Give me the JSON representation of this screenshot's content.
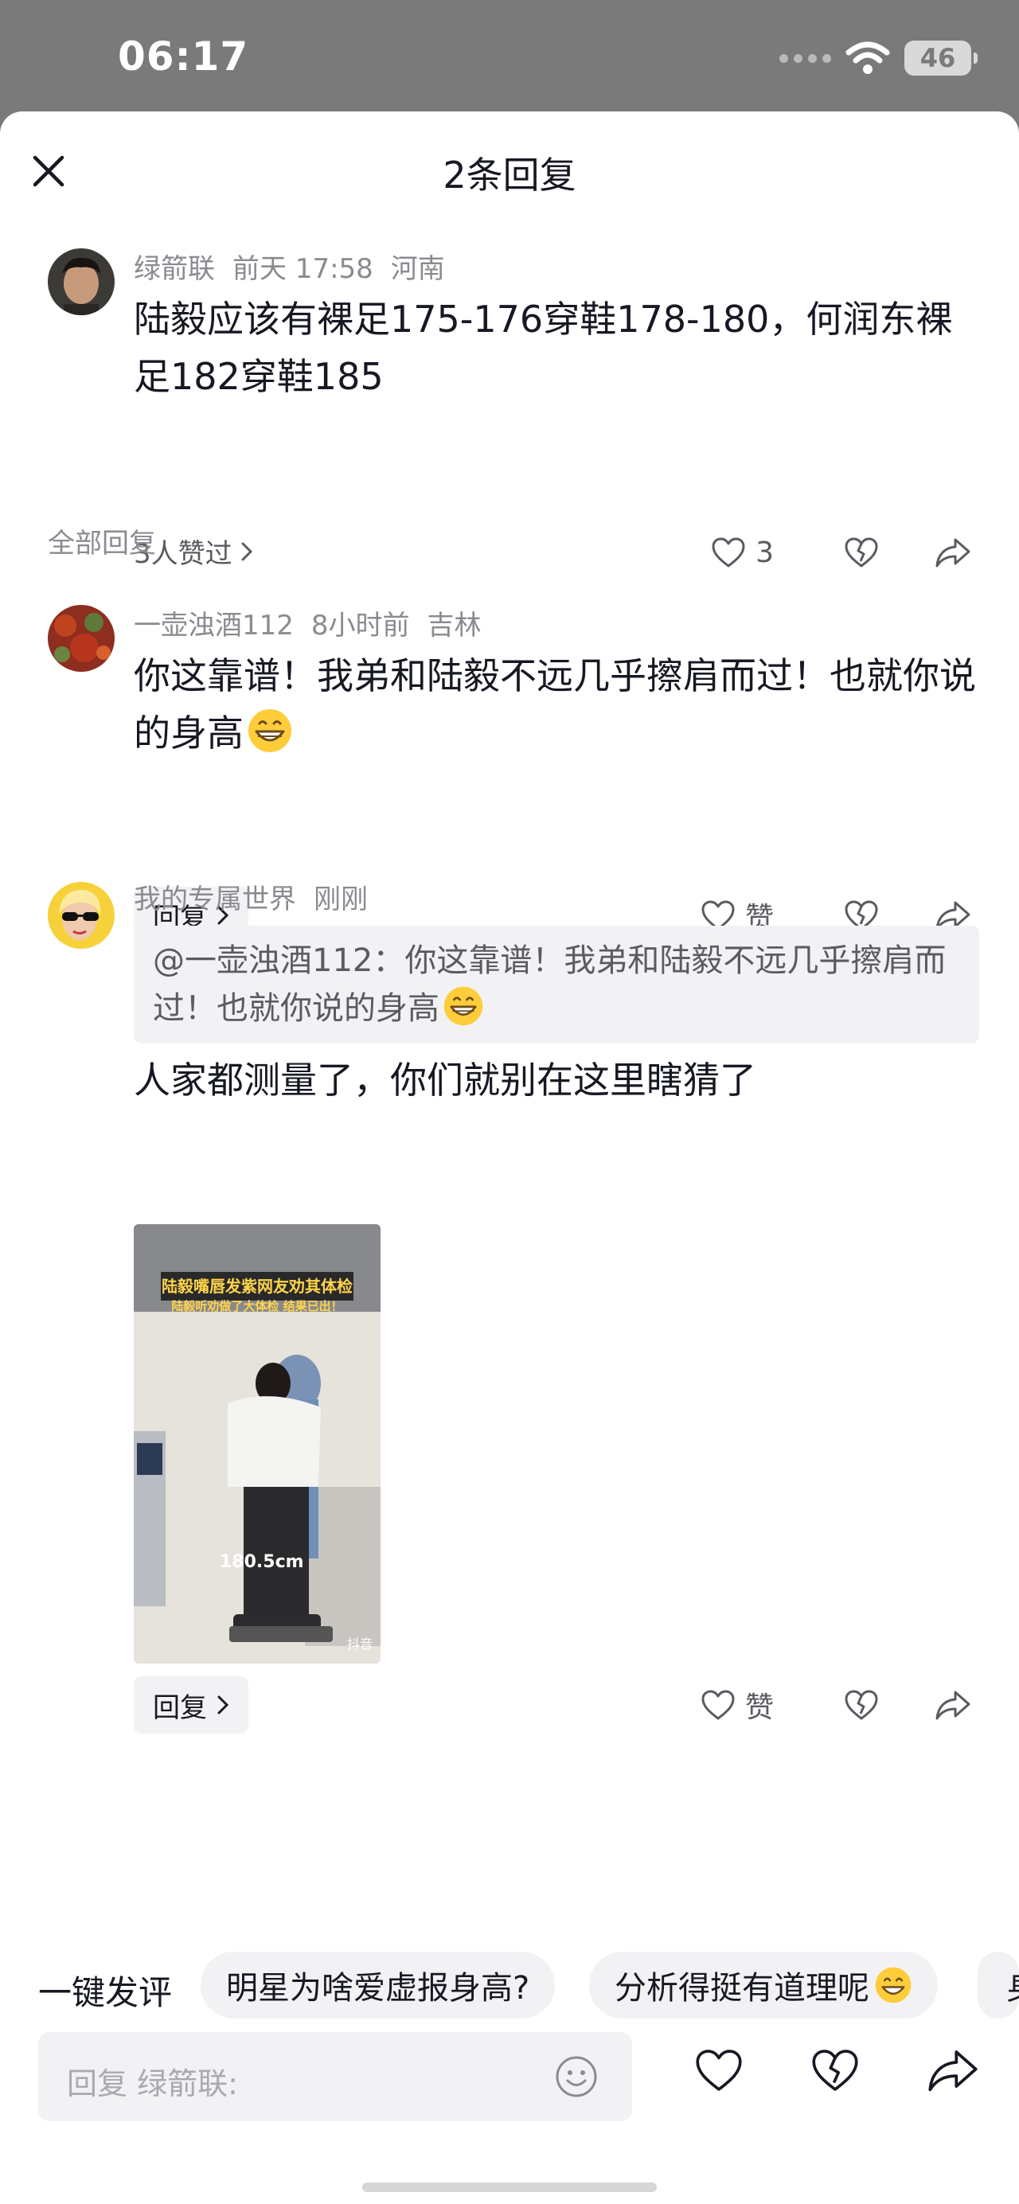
{
  "status": {
    "time": "06:17",
    "battery": "46"
  },
  "header": {
    "title": "2条回复",
    "close_icon": "close-icon"
  },
  "main_comment": {
    "author": "绿箭联",
    "time": "前天 17:58",
    "location": "河南",
    "text": "陆毅应该有裸足175-176穿鞋178-180，何润东裸足182穿鞋185",
    "likes_link": "3人赞过",
    "like_count": "3"
  },
  "section_label": "全部回复",
  "replies": [
    {
      "author": "一壶浊酒112",
      "time": "8小时前",
      "location": "吉林",
      "text": "你这靠谱！我弟和陆毅不远几乎擦肩而过！也就你说的身高",
      "emoji": "grinning-emoji",
      "reply_label": "回复",
      "like_label": "赞"
    },
    {
      "author": "我的专属世界",
      "time": "刚刚",
      "quote": "@一壶浊酒112：你这靠谱！我弟和陆毅不远几乎擦肩而过！也就你说的身高",
      "text": "人家都测量了，你们就别在这里瞎猜了",
      "image": {
        "caption_top": "陆毅嘴唇发紫网友劝其体检",
        "caption_sub": "陆毅听劝做了大体检 结果已出！",
        "measure": "180.5cm",
        "watermark": "抖音"
      },
      "reply_label": "回复",
      "like_label": "赞"
    }
  ],
  "suggestions": {
    "title": "一键发评",
    "chips": [
      "明星为啥爱虚报身高?",
      "分析得挺有道理呢",
      "身"
    ]
  },
  "input": {
    "placeholder": "回复 绿箭联:"
  },
  "colors": {
    "text": "#161823",
    "secondary": "#8a8b91",
    "chip_bg": "#f2f2f4",
    "status_bg": "#7a7a7a"
  }
}
